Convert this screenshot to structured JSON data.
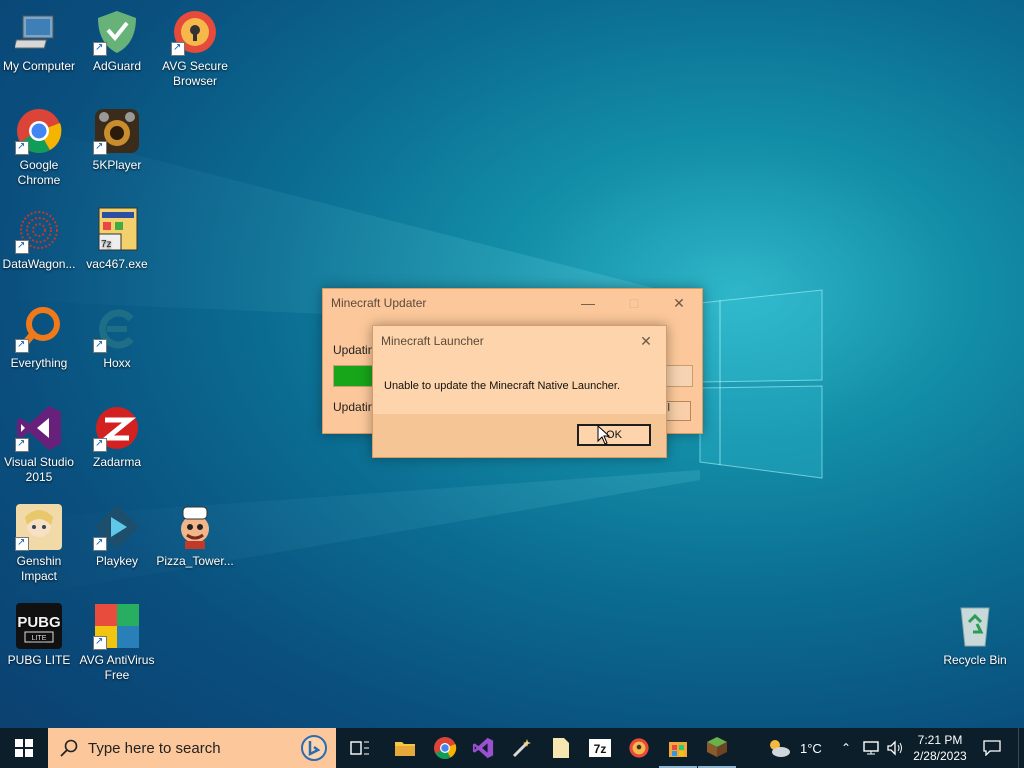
{
  "desktop": {
    "icons": [
      {
        "label": "My Computer"
      },
      {
        "label": "AdGuard"
      },
      {
        "label": "AVG Secure Browser"
      },
      {
        "label": "Google Chrome"
      },
      {
        "label": "5KPlayer"
      },
      {
        "label": "DataWagon..."
      },
      {
        "label": "vac467.exe"
      },
      {
        "label": "Everything"
      },
      {
        "label": "Hoxx"
      },
      {
        "label": "Visual Studio 2015"
      },
      {
        "label": "Zadarma"
      },
      {
        "label": "Genshin Impact"
      },
      {
        "label": "Playkey"
      },
      {
        "label": "Pizza_Tower..."
      },
      {
        "label": "PUBG LITE"
      },
      {
        "label": "AVG AntiVirus Free"
      },
      {
        "label": "Recycle Bin"
      }
    ]
  },
  "updater_window": {
    "title": "Minecraft Updater",
    "line1": "Updating",
    "line2": "Updating",
    "progress": 0.12,
    "button_glyph": "l"
  },
  "launcher_dialog": {
    "title": "Minecraft Launcher",
    "message": "Unable to update the Minecraft Native Launcher.",
    "ok_label": "OK"
  },
  "taskbar": {
    "search_placeholder": "Type here to search",
    "weather": "1°C",
    "time": "7:21 PM",
    "date": "2/28/2023",
    "apps": [
      "task-view-icon",
      "file-explorer-icon",
      "chrome-icon",
      "visual-studio-icon",
      "wand-icon",
      "file-icon",
      "7zip-icon",
      "avg-browser-icon",
      "store-icon",
      "minecraft-icon"
    ]
  },
  "colors": {
    "dialog_bg": "#fcc89b",
    "taskbar_bg": "#0c1e2a",
    "progress_green": "#17a51a"
  }
}
